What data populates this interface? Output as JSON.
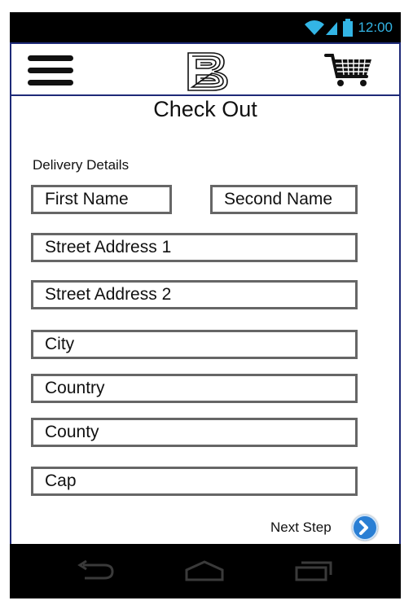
{
  "status_bar": {
    "time": "12:00",
    "icons": [
      "wifi-icon",
      "signal-icon",
      "battery-icon"
    ],
    "color": "#33b5e5"
  },
  "app_bar": {
    "icons": [
      "menu-icon",
      "brand-logo-b",
      "shopping-cart-icon"
    ],
    "border_color": "#1e2a78"
  },
  "page": {
    "title": "Check Out",
    "section_label": "Delivery Details"
  },
  "form": {
    "first_name": "First Name",
    "second_name": "Second Name",
    "street_address_1": "Street Address 1",
    "street_address_2": "Street Address 2",
    "city": "City",
    "country": "Country",
    "county": "County",
    "cap": "Cap"
  },
  "actions": {
    "next_step_label": "Next Step",
    "next_step_icon": "chevron-right-circle-icon",
    "accent_color": "#2a7fd4"
  },
  "nav_bar": {
    "icons": [
      "back-icon",
      "home-icon",
      "recent-apps-icon"
    ]
  }
}
